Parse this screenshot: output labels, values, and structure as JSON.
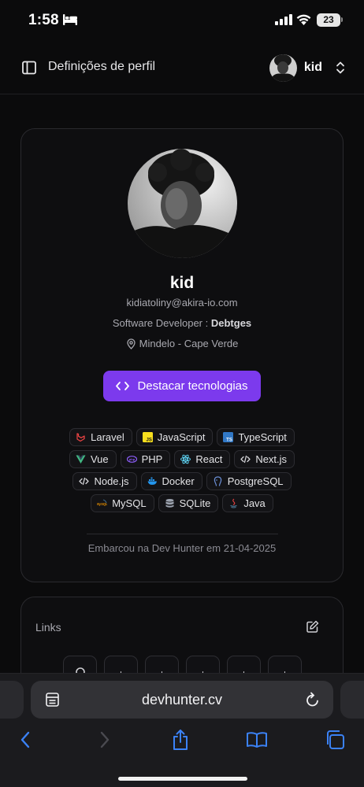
{
  "status_bar": {
    "time": "1:58",
    "battery": "23"
  },
  "header": {
    "title": "Definições de perfil",
    "user_name": "kid"
  },
  "profile": {
    "name": "kid",
    "email": "kidiatoliny@akira-io.com",
    "role": "Software Developer : ",
    "company": "Debtges",
    "location": "Mindelo - Cape Verde",
    "cta_label": "Destacar tecnologias",
    "joined": "Embarcou na Dev Hunter em 21-04-2025"
  },
  "tech_rows": [
    [
      {
        "label": "Laravel",
        "icon": "laravel-icon",
        "color": "#ef4444"
      },
      {
        "label": "JavaScript",
        "icon": "javascript-icon",
        "color": "#f7df1e"
      },
      {
        "label": "TypeScript",
        "icon": "typescript-icon",
        "color": "#3178c6"
      }
    ],
    [
      {
        "label": "Vue",
        "icon": "vue-icon",
        "color": "#41b883"
      },
      {
        "label": "PHP",
        "icon": "php-icon",
        "color": "#8b5cf6"
      },
      {
        "label": "React",
        "icon": "react-icon",
        "color": "#61dafb"
      },
      {
        "label": "Next.js",
        "icon": "code-icon",
        "color": "#d4d4d8"
      }
    ],
    [
      {
        "label": "Node.js",
        "icon": "code-icon",
        "color": "#d4d4d8"
      },
      {
        "label": "Docker",
        "icon": "docker-icon",
        "color": "#2496ed"
      },
      {
        "label": "PostgreSQL",
        "icon": "postgresql-icon",
        "color": "#6b8fd6"
      }
    ],
    [
      {
        "label": "MySQL",
        "icon": "mysql-icon",
        "color": "#e48e00"
      },
      {
        "label": "SQLite",
        "icon": "database-icon",
        "color": "#9ca3af"
      },
      {
        "label": "Java",
        "icon": "java-icon",
        "color": "#ef4444"
      }
    ]
  ],
  "links": {
    "title": "Links"
  },
  "safari": {
    "url": "devhunter.cv"
  },
  "colors": {
    "accent": "#7c3aed",
    "background": "#0b0b0c",
    "safari_blue": "#3b82f6"
  }
}
